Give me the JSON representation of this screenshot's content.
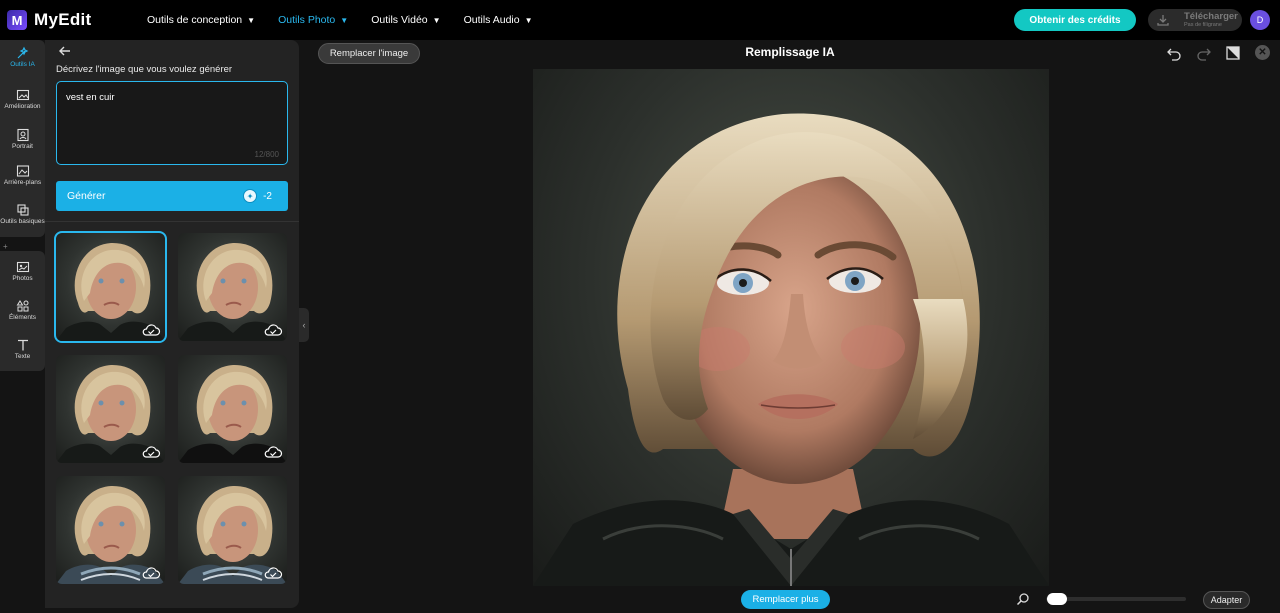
{
  "app": {
    "logo_letter": "M",
    "name": "MyEdit"
  },
  "nav": {
    "items": [
      {
        "label": "Outils de conception",
        "active": false
      },
      {
        "label": "Outils Photo",
        "active": true
      },
      {
        "label": "Outils Vidéo",
        "active": false
      },
      {
        "label": "Outils Audio",
        "active": false
      }
    ],
    "credits_label": "Obtenir des crédits",
    "download_label": "Télécharger",
    "download_sub": "Pas de filigrane",
    "avatar_initial": "D"
  },
  "rail": {
    "items": [
      {
        "label": "Outils IA",
        "icon": "magic-wand-icon",
        "active": true
      },
      {
        "label": "Amélioration",
        "icon": "enhance-icon"
      },
      {
        "label": "Portrait",
        "icon": "portrait-icon"
      },
      {
        "label": "Arrière-plans",
        "icon": "background-icon"
      },
      {
        "label": "Outils basiques",
        "icon": "crop-icon"
      },
      {
        "label": "Photos",
        "icon": "photo-icon"
      },
      {
        "label": "Éléments",
        "icon": "elements-icon"
      },
      {
        "label": "Texte",
        "icon": "text-icon"
      }
    ]
  },
  "panel": {
    "prompt_label": "Décrivez l'image que vous voulez générer",
    "prompt_value": "vest en cuir",
    "prompt_counter": "12/800",
    "generate_label": "Générer",
    "generate_cost": "-2",
    "results": [
      {
        "selected": true,
        "variant": "jacket"
      },
      {
        "selected": false,
        "variant": "jacket"
      },
      {
        "selected": false,
        "variant": "jacket"
      },
      {
        "selected": false,
        "variant": "turtleneck"
      },
      {
        "selected": false,
        "variant": "striped"
      },
      {
        "selected": false,
        "variant": "striped"
      }
    ]
  },
  "canvas": {
    "replace_image_label": "Remplacer l'image",
    "title": "Remplissage IA",
    "replace_more_label": "Remplacer plus",
    "fit_label": "Adapter"
  },
  "colors": {
    "accent": "#2ab8ee",
    "credits": "#13c8c3",
    "avatar": "#6a4fe0"
  }
}
